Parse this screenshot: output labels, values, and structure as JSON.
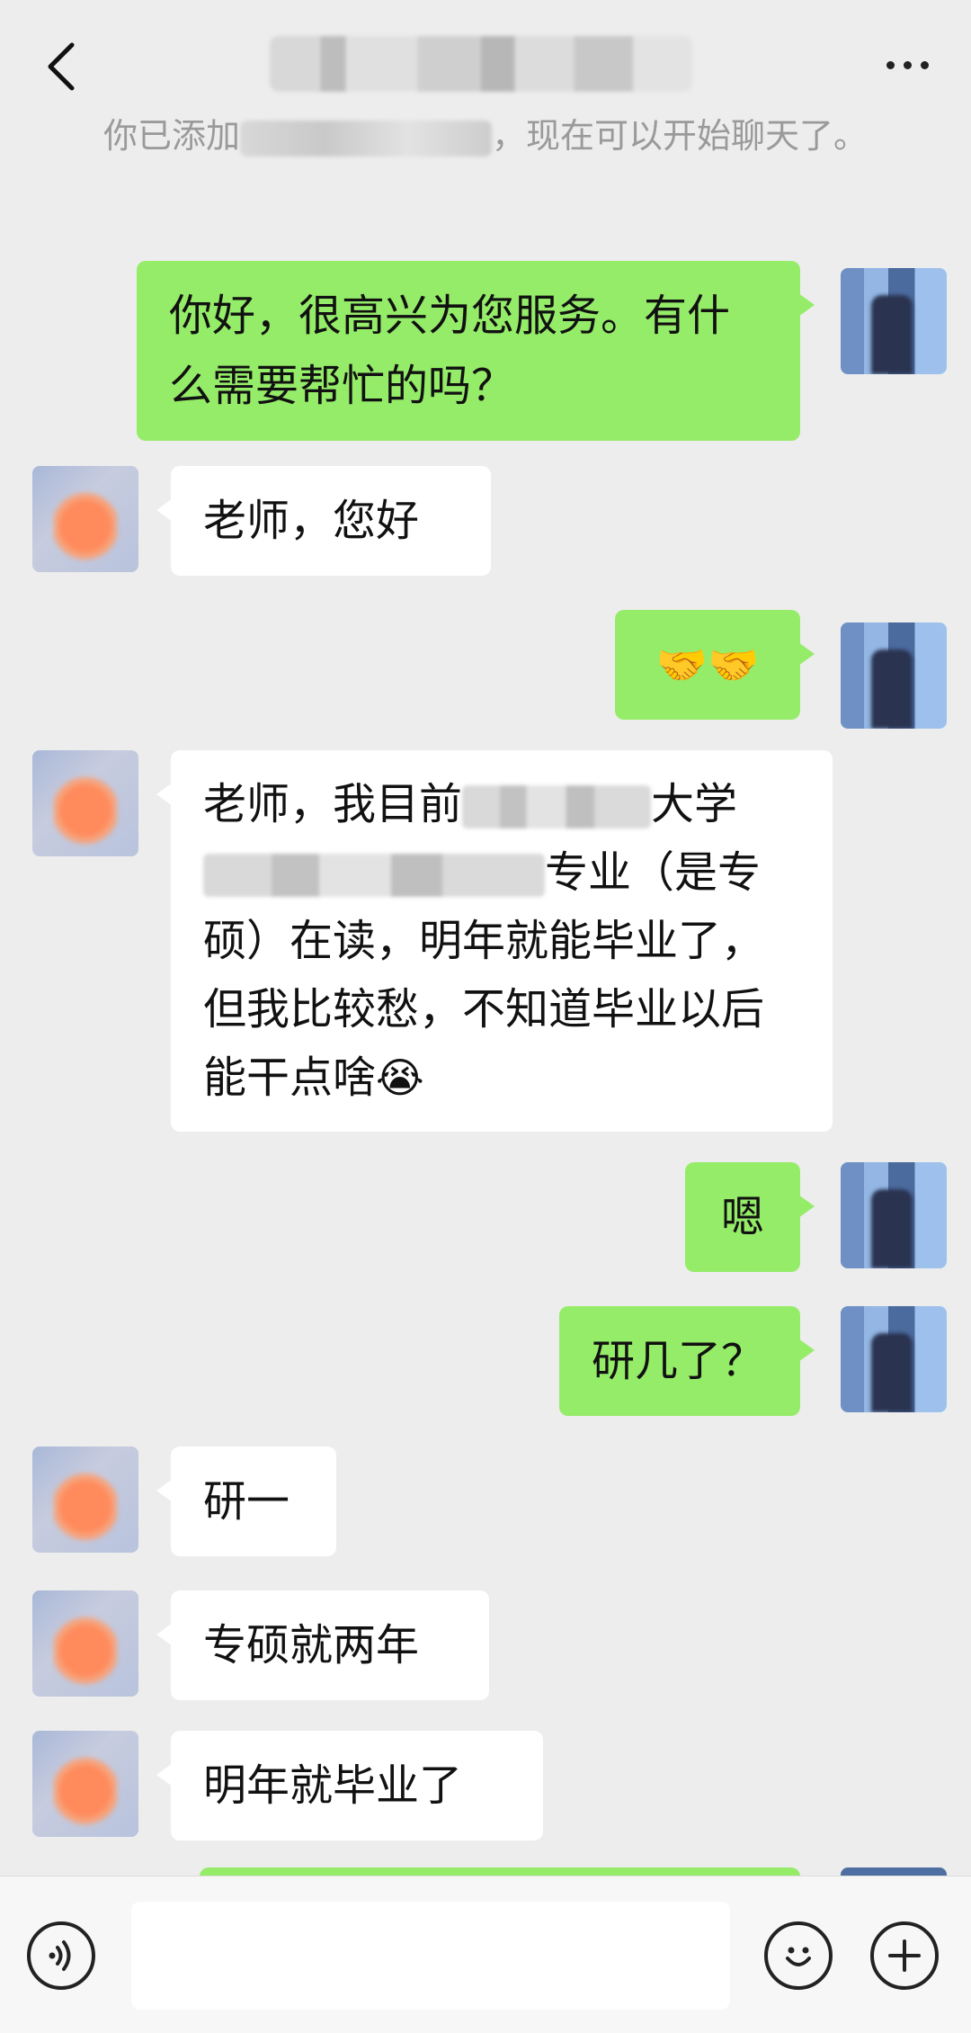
{
  "header": {
    "back_icon": "chevron-left-icon",
    "title_blurred": true,
    "more_icon": "more-dots-icon"
  },
  "system_notice": {
    "prefix": "你已添加",
    "suffix": "，现在可以开始聊天了。"
  },
  "messages": [
    {
      "side": "me",
      "text": "你好，很高兴为您服务。有什么需要帮忙的吗？"
    },
    {
      "side": "them",
      "text": "老师，您好"
    },
    {
      "side": "me",
      "text": "🤝🤝"
    },
    {
      "side": "them",
      "text_a": "老师，我目前",
      "text_b": "大学",
      "text_c": "专业（是专硕）在读，明年就能毕业了，但我比较愁，不知道毕业以后能干点啥",
      "emoji": "😭"
    },
    {
      "side": "me",
      "text": "嗯"
    },
    {
      "side": "me",
      "text": "研几了？"
    },
    {
      "side": "them",
      "text": "研一"
    },
    {
      "side": "them",
      "text": "专硕就两年"
    },
    {
      "side": "them",
      "text": "明年就毕业了"
    }
  ],
  "input_bar": {
    "voice_icon": "voice-icon",
    "emoji_icon": "emoji-icon",
    "plus_icon": "plus-icon"
  },
  "colors": {
    "background": "#ededed",
    "me_bubble": "#95ec69",
    "them_bubble": "#ffffff"
  }
}
